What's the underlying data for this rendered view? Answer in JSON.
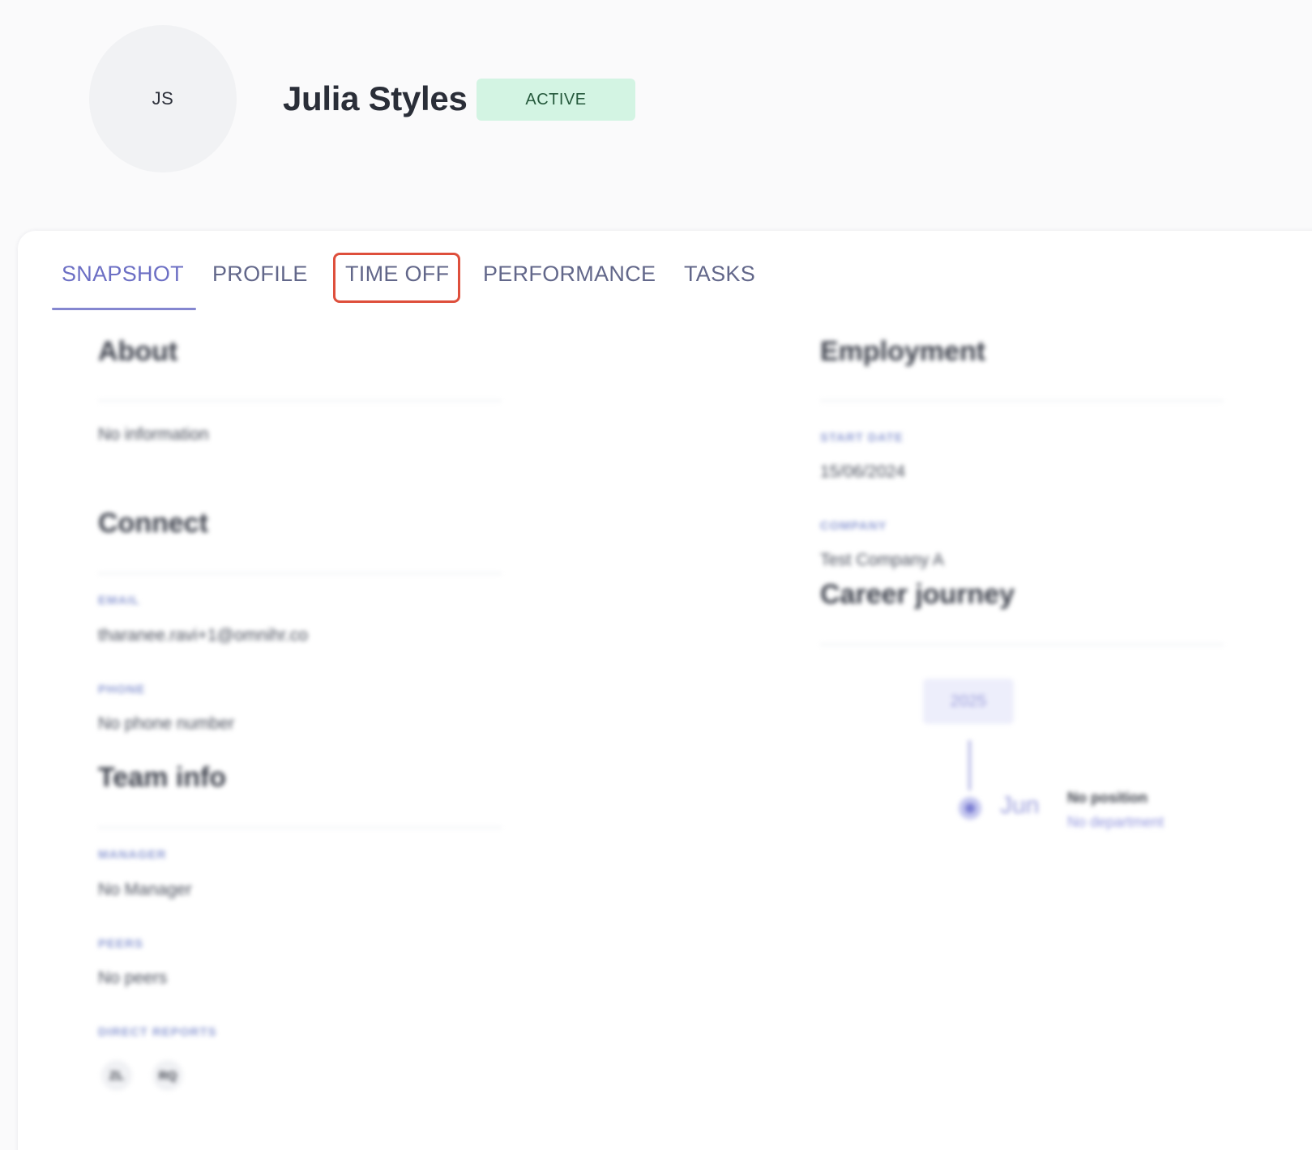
{
  "employee": {
    "initials": "JS",
    "name": "Julia Styles",
    "status": "ACTIVE"
  },
  "tabs": [
    {
      "label": "SNAPSHOT",
      "active": true
    },
    {
      "label": "PROFILE",
      "active": false
    },
    {
      "label": "TIME OFF",
      "active": false,
      "highlighted": true
    },
    {
      "label": "PERFORMANCE",
      "active": false
    },
    {
      "label": "TASKS",
      "active": false
    }
  ],
  "about": {
    "title": "About",
    "text": "No information"
  },
  "connect": {
    "title": "Connect",
    "email_label": "EMAIL",
    "email_value": "tharanee.ravi+1@omnihr.co",
    "phone_label": "PHONE",
    "phone_value": "No phone number"
  },
  "team_info": {
    "title": "Team info",
    "manager_label": "MANAGER",
    "manager_value": "No Manager",
    "peers_label": "PEERS",
    "peers_value": "No peers",
    "direct_reports_label": "DIRECT REPORTS",
    "direct_reports": [
      "ZL",
      "RQ"
    ]
  },
  "employment": {
    "title": "Employment",
    "start_date_label": "START DATE",
    "start_date_value": "15/06/2024",
    "company_label": "COMPANY",
    "company_value": "Test Company A"
  },
  "career_journey": {
    "title": "Career journey",
    "year": "2025",
    "month": "Jun",
    "position": "No position",
    "department": "No department"
  },
  "colors": {
    "accent": "#6c6fc4",
    "badge_bg": "#d3f4e3",
    "badge_text": "#25593c",
    "focus_ring": "#de4f3c"
  }
}
